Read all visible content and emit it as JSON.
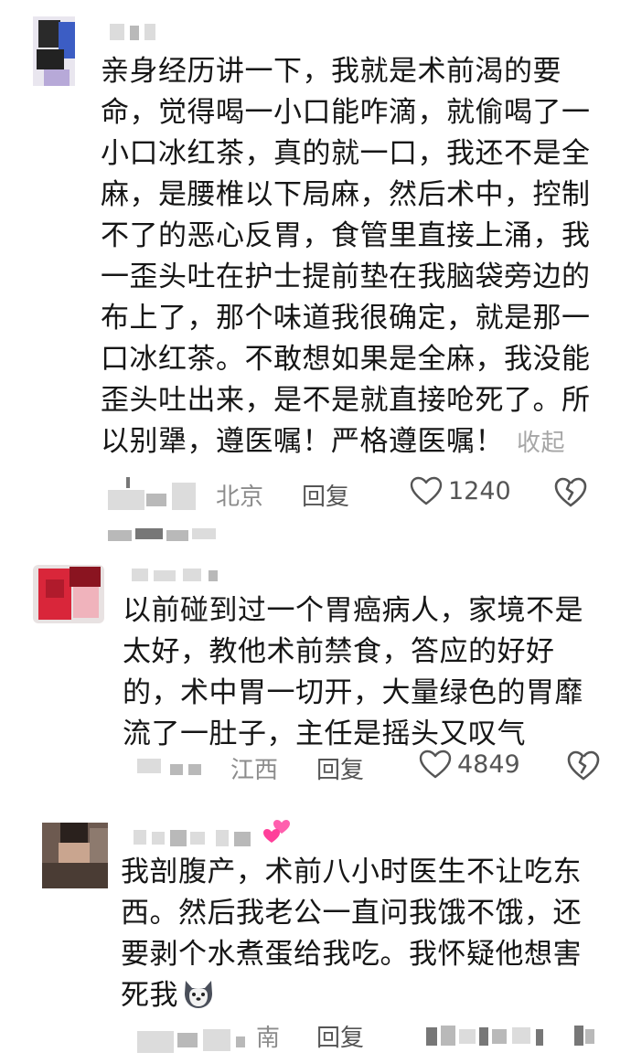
{
  "comments": [
    {
      "text": "亲身经历讲一下，我就是术前渴的要命，觉得喝一小口能咋滴，就偷喝了一小口冰红茶，真的就一口，我还不是全麻，是腰椎以下局麻，然后术中，控制不了的恶心反胃，食管里直接上涌，我一歪头吐在护士提前垫在我脑袋旁边的布上了，那个味道我很确定，就是那一口冰红茶。不敢想如果是全麻，我没能歪头吐出来，是不是就直接呛死了。所以别犟，遵医嘱！严格遵医嘱！",
      "collapse_label": "收起",
      "location": "北京",
      "reply_label": "回复",
      "likes": "1240"
    },
    {
      "text": "以前碰到过一个胃癌病人，家境不是太好，教他术前禁食，答应的好好的，术中胃一切开，大量绿色的胃靡流了一肚子，主任是摇头又叹气",
      "location": "江西",
      "reply_label": "回复",
      "likes": "4849"
    },
    {
      "text": "我剖腹产，术前八小时医生不让吃东西。然后我老公一直问我饿不饿，还要剥个水煮蛋给我吃。我怀疑他想害死我",
      "location": "南",
      "reply_label": "回复"
    }
  ],
  "icons": [
    "heart-icon",
    "broken-heart-icon",
    "dog-emoji-icon",
    "hearts-emoji-icon"
  ]
}
